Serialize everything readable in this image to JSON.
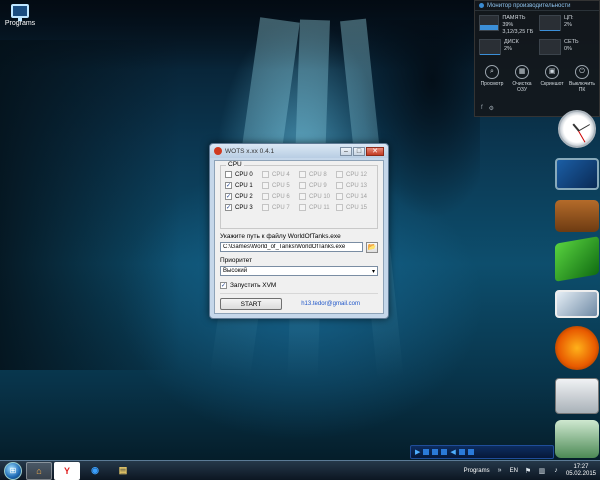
{
  "desktop": {
    "icon_label": "Programs"
  },
  "perf_monitor": {
    "title": "Монитор производительности",
    "ram": {
      "label": "ПАМЯТЬ 39%",
      "value": "3,12/3,25 ГБ",
      "percent": 39
    },
    "cpu": {
      "label": "ЦП:",
      "value": "2%",
      "percent": 2
    },
    "disk": {
      "label": "ДИСК",
      "value": "2%",
      "percent": 2
    },
    "net": {
      "label": "СЕТЬ",
      "value": "0%",
      "percent": 0
    },
    "actions": [
      {
        "icon": "search-icon",
        "glyph": "⌕",
        "label": "Просмотр"
      },
      {
        "icon": "ram-icon",
        "glyph": "▦",
        "label": "Очистка ОЗУ"
      },
      {
        "icon": "screenshot-icon",
        "glyph": "▣",
        "label": "Скриншот"
      },
      {
        "icon": "power-icon",
        "glyph": "⏻",
        "label": "Выключить ПК"
      }
    ]
  },
  "window": {
    "title": "WOTS x.xx 0.4.1",
    "cpu_group_label": "CPU",
    "cpus": [
      {
        "label": "CPU 0",
        "checked": false,
        "enabled": true
      },
      {
        "label": "CPU 4",
        "checked": false,
        "enabled": false
      },
      {
        "label": "CPU 8",
        "checked": false,
        "enabled": false
      },
      {
        "label": "CPU 12",
        "checked": false,
        "enabled": false
      },
      {
        "label": "CPU 1",
        "checked": true,
        "enabled": true
      },
      {
        "label": "CPU 5",
        "checked": false,
        "enabled": false
      },
      {
        "label": "CPU 9",
        "checked": false,
        "enabled": false
      },
      {
        "label": "CPU 13",
        "checked": false,
        "enabled": false
      },
      {
        "label": "CPU 2",
        "checked": true,
        "enabled": true
      },
      {
        "label": "CPU 6",
        "checked": false,
        "enabled": false
      },
      {
        "label": "CPU 10",
        "checked": false,
        "enabled": false
      },
      {
        "label": "CPU 14",
        "checked": false,
        "enabled": false
      },
      {
        "label": "CPU 3",
        "checked": true,
        "enabled": true
      },
      {
        "label": "CPU 7",
        "checked": false,
        "enabled": false
      },
      {
        "label": "CPU 11",
        "checked": false,
        "enabled": false
      },
      {
        "label": "CPU 15",
        "checked": false,
        "enabled": false
      }
    ],
    "path_label": "Укажите путь к файлу WorldOfTanks.exe",
    "path_value": "C:\\Games\\World_of_Tanks\\WorldOfTanks.exe",
    "priority_label": "Приоритет",
    "priority_value": "Высокий",
    "launch_label": "Запустить XVM",
    "launch_checked": true,
    "start_label": "START",
    "email": "h13.tedor@gmail.com"
  },
  "taskbar": {
    "tray_label": "Programs",
    "lang": "EN",
    "time": "17:27",
    "date": "05.02.2015"
  }
}
